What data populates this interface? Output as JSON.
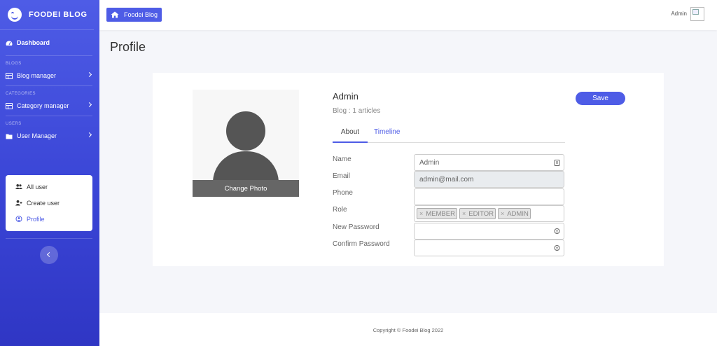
{
  "brand": {
    "name": "FOODEI BLOG"
  },
  "sidebar": {
    "dashboard": "Dashboard",
    "sections": [
      {
        "heading": "BLOGS",
        "item": "Blog manager"
      },
      {
        "heading": "CATEGORIES",
        "item": "Category manager"
      },
      {
        "heading": "USERS",
        "item": "User Manager"
      }
    ],
    "submenu": [
      {
        "label": "All user",
        "icon": "users-icon"
      },
      {
        "label": "Create user",
        "icon": "user-plus-icon"
      },
      {
        "label": "Profile",
        "icon": "user-circle-icon",
        "active": true
      }
    ]
  },
  "topbar": {
    "home_label": "Foodei Blog",
    "user_label": "Admin"
  },
  "page": {
    "title": "Profile"
  },
  "profile": {
    "change_photo": "Change Photo",
    "name": "Admin",
    "subtitle": "Blog : 1 articles",
    "save_label": "Save",
    "tabs": [
      "About",
      "Timeline"
    ],
    "fields": [
      {
        "label": "Name",
        "value": "Admin"
      },
      {
        "label": "Email",
        "value": "admin@mail.com"
      },
      {
        "label": "Phone",
        "value": ""
      },
      {
        "label": "Role",
        "tags": [
          "MEMBER",
          "EDITOR",
          "ADMIN"
        ]
      },
      {
        "label": "New Password",
        "value": ""
      },
      {
        "label": "Confirm Password",
        "value": ""
      }
    ]
  },
  "footer": {
    "copyright": "Copyright © Foodei Blog 2022"
  },
  "colors": {
    "accent": "#4e5ce6",
    "sidebar_bottom": "#2f36c4"
  }
}
